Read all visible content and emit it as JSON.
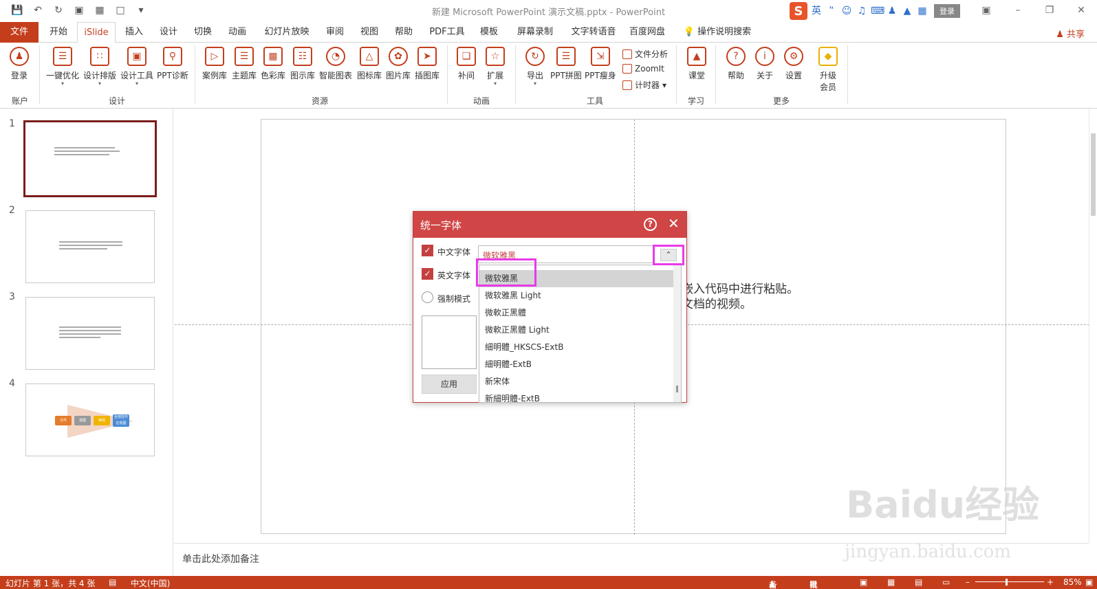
{
  "window": {
    "title": "新建 Microsoft PowerPoint 演示文稿.pptx  -  PowerPoint",
    "ime_brand": "S",
    "ime_lang": "英",
    "login_label": "登录"
  },
  "tabs": [
    {
      "label": "文件"
    },
    {
      "label": "开始"
    },
    {
      "label": "iSlide"
    },
    {
      "label": "插入"
    },
    {
      "label": "设计"
    },
    {
      "label": "切换"
    },
    {
      "label": "动画"
    },
    {
      "label": "幻灯片放映"
    },
    {
      "label": "审阅"
    },
    {
      "label": "视图"
    },
    {
      "label": "帮助"
    },
    {
      "label": "PDF工具"
    },
    {
      "label": "模板"
    },
    {
      "label": "屏幕录制"
    },
    {
      "label": "文字转语音"
    },
    {
      "label": "百度网盘"
    },
    {
      "label": "操作说明搜索"
    }
  ],
  "share_label": "共享",
  "ribbon": {
    "buttons": [
      {
        "label": "登录"
      },
      {
        "label": "一键优化"
      },
      {
        "label": "设计排版"
      },
      {
        "label": "设计工具"
      },
      {
        "label": "PPT诊断"
      },
      {
        "label": "案例库"
      },
      {
        "label": "主题库"
      },
      {
        "label": "色彩库"
      },
      {
        "label": "图示库"
      },
      {
        "label": "智能图表"
      },
      {
        "label": "图标库"
      },
      {
        "label": "图片库"
      },
      {
        "label": "插图库"
      },
      {
        "label": "补间"
      },
      {
        "label": "扩展"
      },
      {
        "label": "导出"
      },
      {
        "label": "PPT拼图"
      },
      {
        "label": "PPT瘦身"
      },
      {
        "label": "课堂"
      },
      {
        "label": "帮助"
      },
      {
        "label": "关于"
      },
      {
        "label": "设置"
      },
      {
        "label": "升级\n会员"
      }
    ],
    "small": [
      {
        "label": "文件分析"
      },
      {
        "label": "ZoomIt"
      },
      {
        "label": "计时器"
      }
    ],
    "groups": [
      {
        "label": "账户"
      },
      {
        "label": "设计"
      },
      {
        "label": "资源"
      },
      {
        "label": "动画"
      },
      {
        "label": "工具"
      },
      {
        "label": "学习"
      },
      {
        "label": "更多"
      }
    ]
  },
  "slides": [
    {
      "num": "1"
    },
    {
      "num": "2"
    },
    {
      "num": "3"
    },
    {
      "num": "4"
    }
  ],
  "slide4_chips": [
    "文件",
    "视图",
    "审阅",
    "全部控件 在视图"
  ],
  "slide_text": {
    "line1": "。",
    "line2": "嵌入代码中进行粘贴。",
    "line3": "文档的视频。"
  },
  "notes_placeholder": "单击此处添加备注",
  "status": {
    "slide_info": "幻灯片 第 1 张，共 4 张",
    "language": "中文(中国)",
    "notes": "备注",
    "comments": "批注",
    "zoom": "85%"
  },
  "dialog": {
    "title": "统一字体",
    "help": "?",
    "cn_font_label": "中文字体",
    "en_font_label": "英文字体",
    "force_label": "强制模式",
    "current_font": "微软雅黑",
    "apply_label": "应用",
    "options": [
      "微软雅黑",
      "微软雅黑 Light",
      "微軟正黑體",
      "微軟正黑體 Light",
      "細明體_HKSCS-ExtB",
      "細明體-ExtB",
      "新宋体",
      "新細明體-ExtB"
    ]
  },
  "watermark": {
    "brand": "Baidu经验",
    "url": "jingyan.baidu.com"
  },
  "colors": {
    "accent": "#c43e1c",
    "dialog_header": "#d04545",
    "highlight": "#e83be8"
  }
}
